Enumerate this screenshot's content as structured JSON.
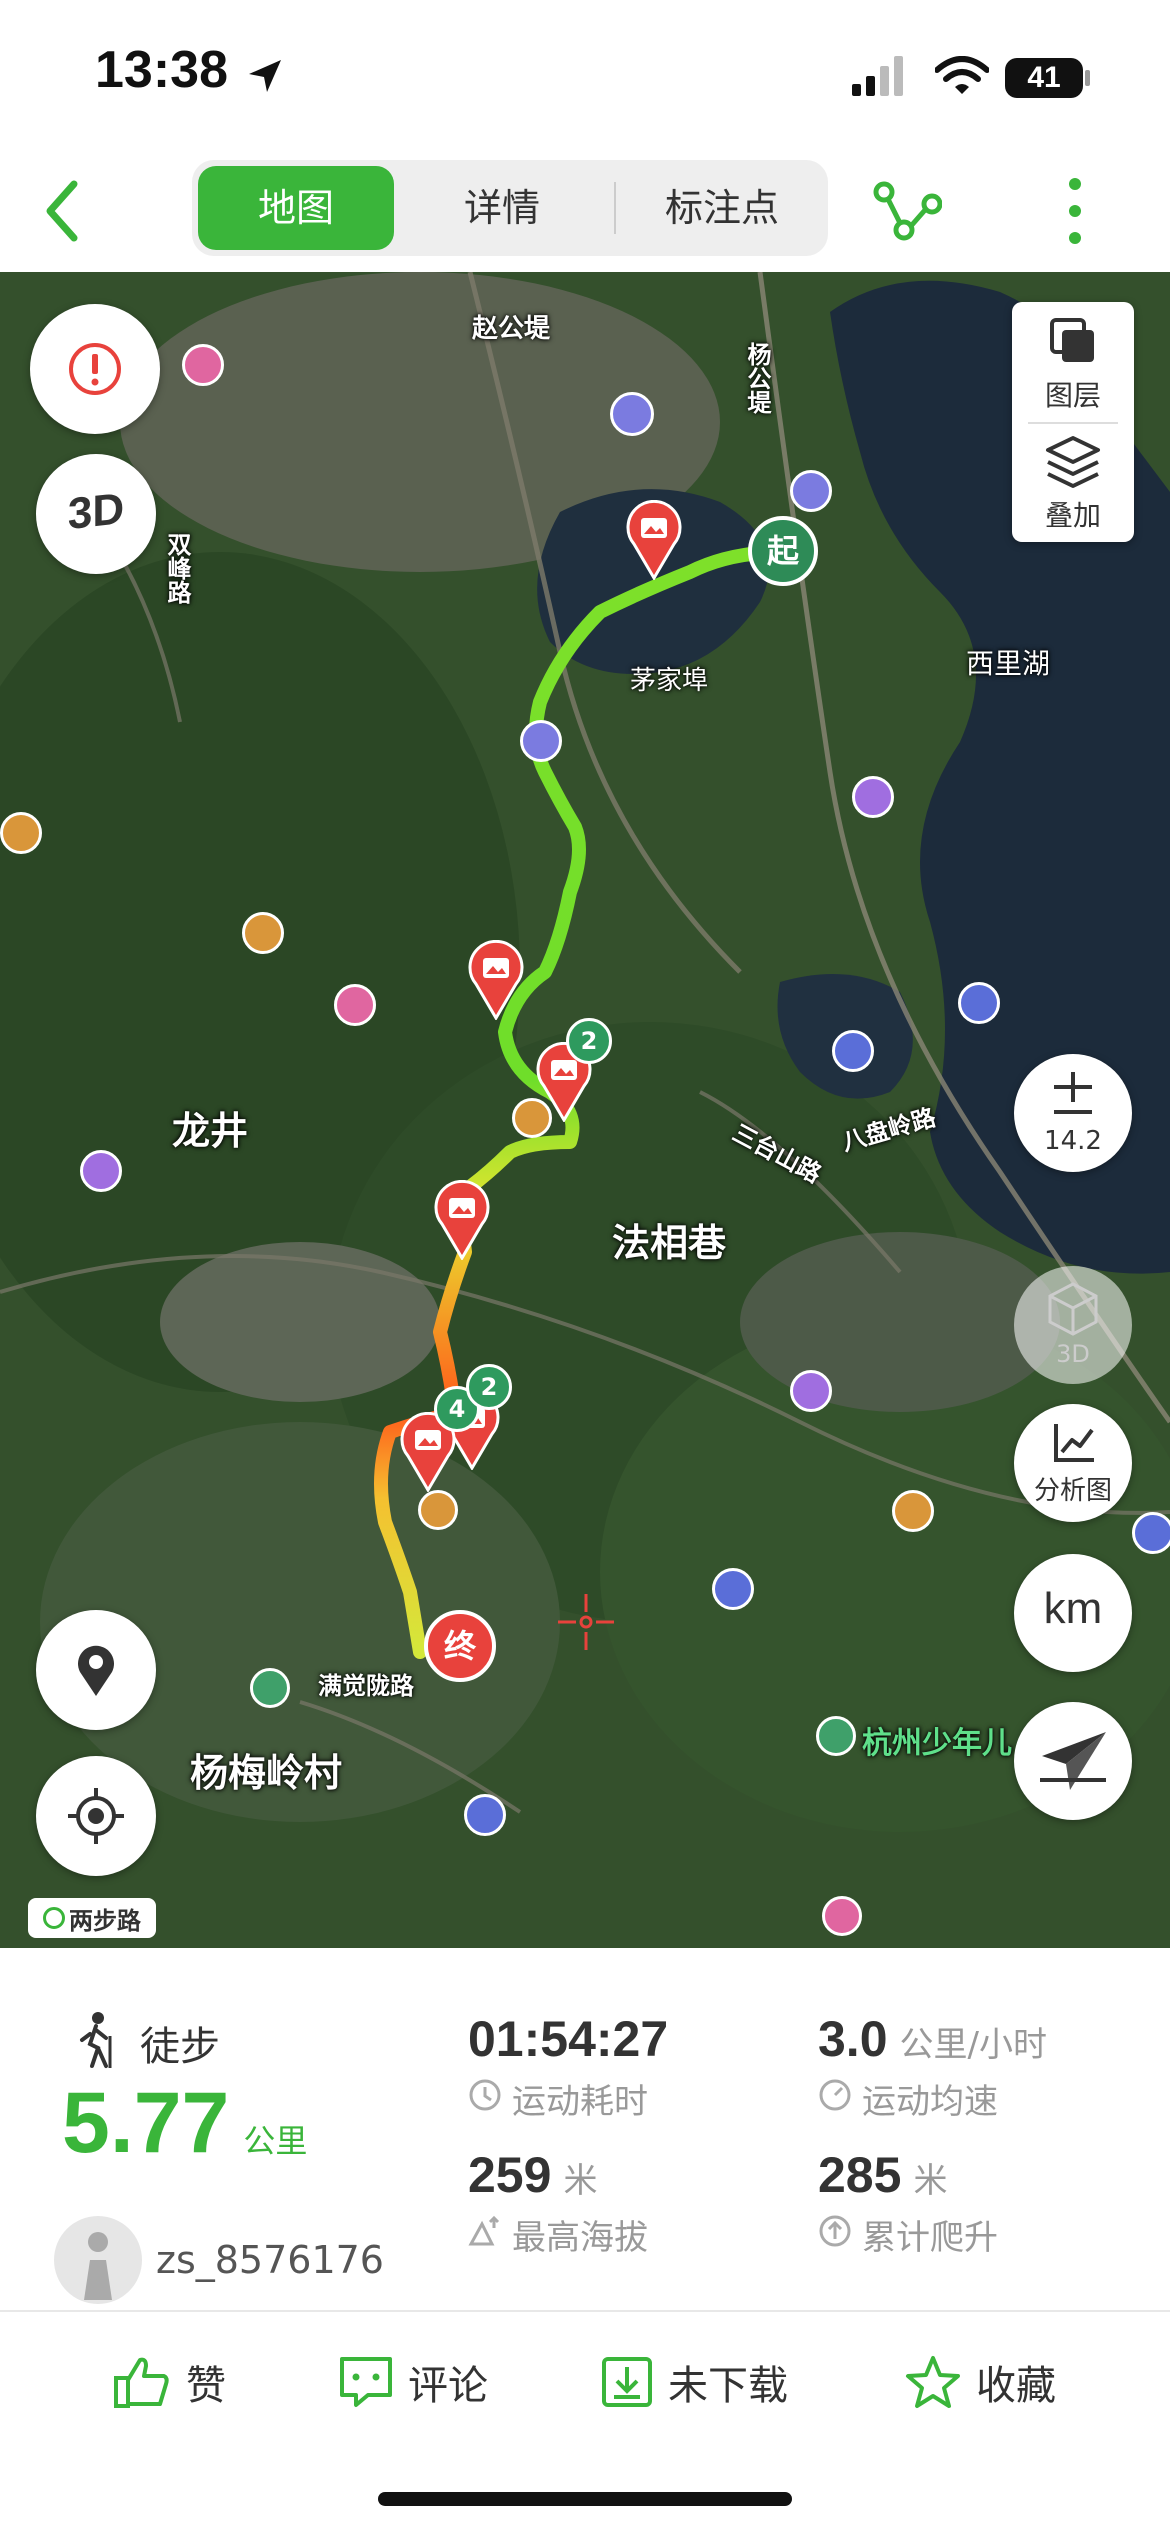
{
  "status_bar": {
    "time": "13:38",
    "battery": "41"
  },
  "nav": {
    "tabs": [
      {
        "label": "地图",
        "active": true
      },
      {
        "label": "详情",
        "active": false
      },
      {
        "label": "标注点",
        "active": false
      }
    ]
  },
  "map": {
    "labels": {
      "zhaogongdi": "赵公堤",
      "yanggongdi": "杨公堤",
      "shuangfeng": "双峰路",
      "maojiabu": "茅家埠",
      "xilihu": "西里湖",
      "longjing": "龙井",
      "faxiangxiang": "法相巷",
      "santaishan": "三台山路",
      "bapanling": "八盘岭路",
      "manjuelong": "满觉陇路",
      "yangmeiling": "杨梅岭村",
      "shaonian": "杭州少年儿"
    },
    "start_label": "起",
    "end_label": "终",
    "cluster_counts": [
      "2",
      "4",
      "2"
    ],
    "layers_label": "图层",
    "overlay_label": "叠加",
    "zoom_level": "14.2",
    "btn_3d_label": "3D",
    "analysis_label": "分析图",
    "unit_label": "km",
    "watermark": "两步路"
  },
  "stats": {
    "activity": "徒步",
    "distance": "5.77",
    "distance_unit": "公里",
    "username": "zs_8576176",
    "duration": "01:54:27",
    "duration_label": "运动耗时",
    "speed": "3.0",
    "speed_unit": "公里/小时",
    "speed_label": "运动均速",
    "max_alt": "259",
    "max_alt_unit": "米",
    "max_alt_label": "最高海拔",
    "climb": "285",
    "climb_unit": "米",
    "climb_label": "累计爬升"
  },
  "actions": {
    "like": "赞",
    "comment": "评论",
    "download": "未下载",
    "favorite": "收藏"
  },
  "colors": {
    "accent": "#3ab53a",
    "track_start": "#66dd22",
    "track_end": "#ff5a1a",
    "marker": "#e8423c"
  }
}
